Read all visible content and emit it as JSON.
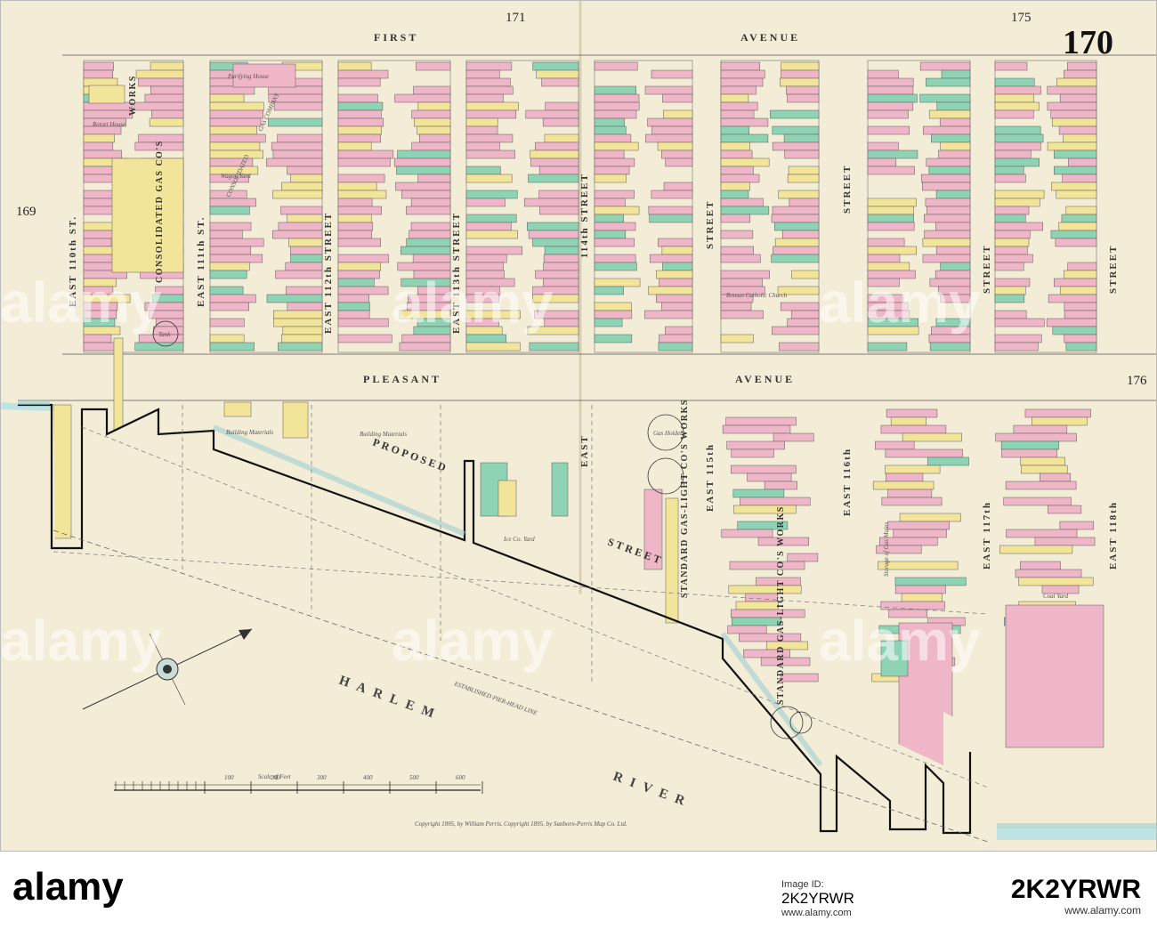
{
  "plate": {
    "number": "170",
    "ref_top_left": "171",
    "ref_top_right": "175",
    "ref_left": "169",
    "ref_right": "176"
  },
  "streets": {
    "first": "FIRST",
    "avenue_top": "AVENUE",
    "pleasant": "PLEASANT",
    "avenue_bottom": "AVENUE",
    "st_110": "EAST   110th   ST.",
    "st_111": "EAST   111th   ST.",
    "st_112": "EAST   112th   STREET",
    "st_113": "EAST   113th   STREET",
    "st_114": "114th   STREET",
    "st_115_top": "STREET",
    "st_116_top": "STREET",
    "st_117_top": "STREET",
    "st_118_top": "STREET",
    "east_114_lower": "EAST",
    "east_115_lower": "EAST  115th",
    "east_116_lower": "EAST  116th",
    "east_117_lower": "EAST  117th",
    "east_118_lower": "EAST  118th",
    "street_diag": "STREET",
    "proposed": "PROPOSED"
  },
  "water": {
    "harlem": "HARLEM",
    "river": "RIVER",
    "pierhead": "ESTABLISHED  PIER-HEAD  LINE"
  },
  "works": {
    "consolidated_gas": "CONSOLIDATED  GAS  CO'S",
    "works": "WORKS",
    "consolidated_small": "CONSOLIDATED",
    "gas_company": "GAS  COMPANY",
    "standard_1": "STANDARD  GAS-LIGHT  CO'S  WORKS",
    "standard_2": "STANDARD  GAS-LIGHT  CO'S  WORKS"
  },
  "annotations": {
    "building_materials": "Building Materials",
    "building_materials_2": "Building Materials",
    "ice_yard": "Ice Co. Yard",
    "coal_yard": "Coal Yard",
    "tank": "Tank",
    "gas_holder": "Gas Holder",
    "retort_house": "Retort House",
    "purifying_house": "Purifying House",
    "wagon_yard": "Wagon Yard",
    "roman_catholic": "Roman Catholic Church",
    "storage": "Storage of Gas Mains",
    "scale": "Scale of Feet",
    "scale_ticks": [
      "100",
      "200",
      "300",
      "400",
      "500",
      "600"
    ],
    "copyright_left": "Copyright 1895, by William Perris.",
    "copyright_right": "Copyright 1895, by Sanborn-Perris Map Co. Ltd."
  },
  "watermark": {
    "text": "alamy"
  },
  "footer": {
    "logo": "alamy",
    "image_id_label": "Image ID:",
    "image_id": "2K2YRWR",
    "site": "www.alamy.com",
    "code": "2K2YRWR"
  },
  "colors": {
    "paper": "#f3ecd6",
    "brick": "#eeb6c6",
    "frame": "#f2e59a",
    "stone": "#8fd3b5",
    "water": "#bfe3e3",
    "ink": "#2a2a2a"
  }
}
